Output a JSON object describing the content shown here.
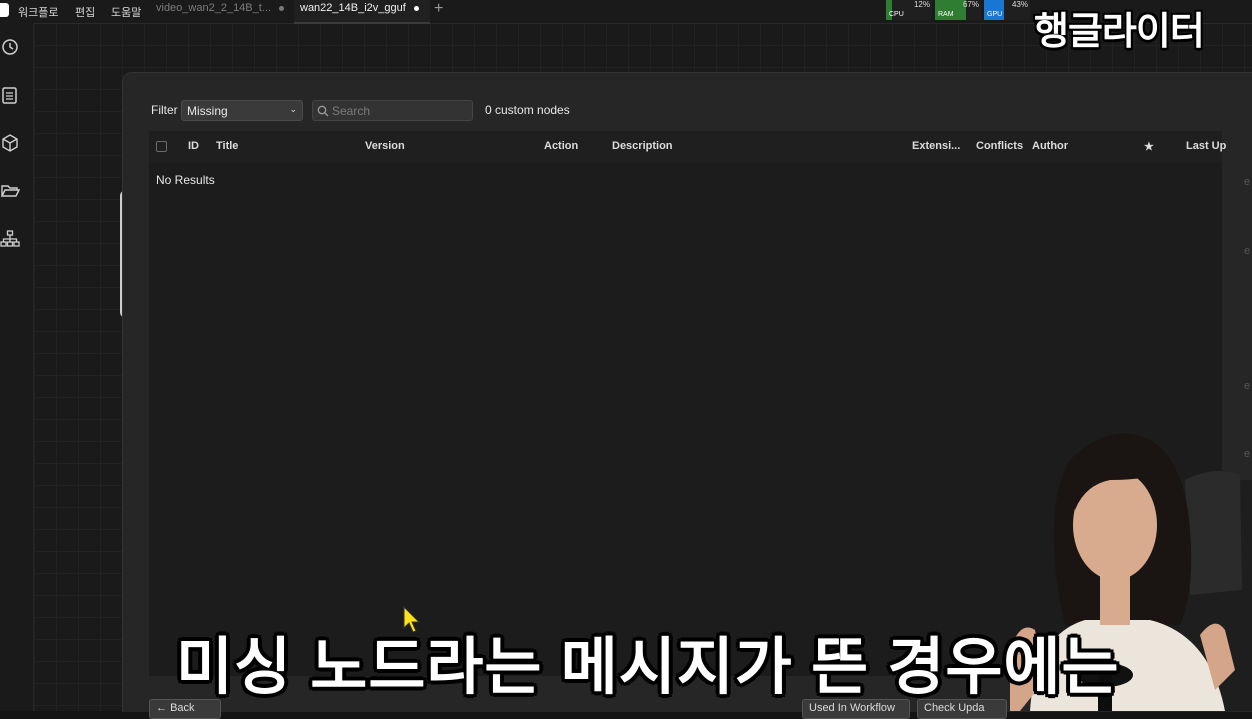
{
  "menubar": {
    "items": [
      "워크플로",
      "편집",
      "도움말"
    ],
    "tabs": [
      {
        "label": "video_wan2_2_14B_t...",
        "active": false
      },
      {
        "label": "wan22_14B_i2v_gguf",
        "active": true
      }
    ],
    "add_tab_icon": "plus-icon"
  },
  "monitors": [
    {
      "label": "CPU",
      "percent": "12%",
      "fill": 0.12,
      "color": "#2e7d32"
    },
    {
      "label": "RAM",
      "percent": "67%",
      "fill": 0.67,
      "color": "#2e7d32"
    },
    {
      "label": "GPU",
      "percent": "43%",
      "fill": 0.43,
      "color": "#1976d2"
    }
  ],
  "channel_logo": "행글라이터",
  "sidebar_icons": [
    "history-icon",
    "list-icon",
    "cube-icon",
    "folder-icon",
    "hierarchy-icon"
  ],
  "dialog": {
    "filter_label": "Filter",
    "filter_value": "Missing",
    "search_placeholder": "Search",
    "count_text": "0 custom nodes",
    "columns": [
      "ID",
      "Title",
      "Version",
      "Action",
      "Description",
      "Extensi...",
      "Conflicts",
      "Author",
      "★",
      "Last Up"
    ],
    "empty_text": "No Results",
    "footer_buttons": [
      "Back",
      "Used In Workflow",
      "Check Upda"
    ]
  },
  "subtitle": "미싱 노드라는 메시지가 뜬 경우에는"
}
